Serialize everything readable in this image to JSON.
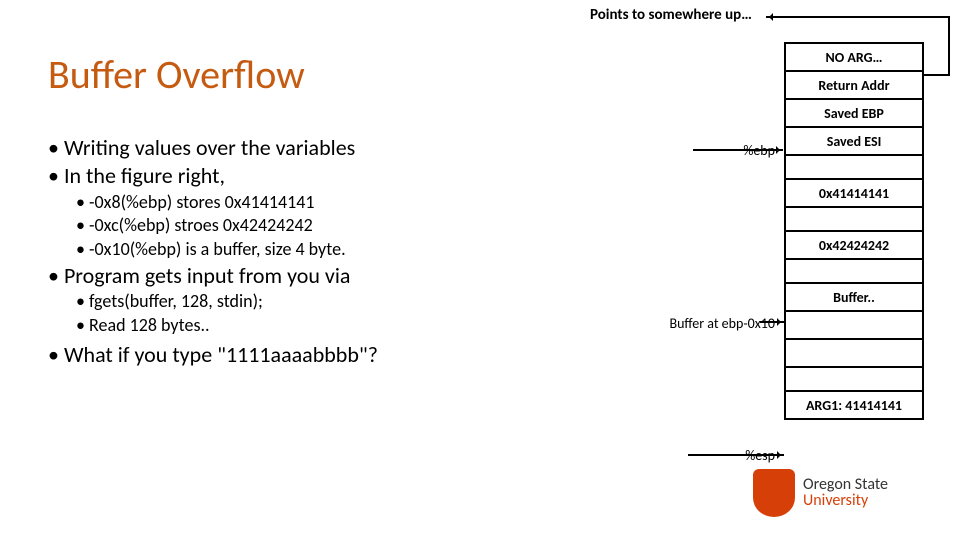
{
  "top_note": "Points to somewhere up…",
  "title": "Buffer Overflow",
  "bullets": {
    "b1": "Writing values over the variables",
    "b2": "In the figure right,",
    "sub1": "-0x8(%ebp) stores 0x41414141",
    "sub2": "-0xc(%ebp) stroes 0x42424242",
    "sub3": "-0x10(%ebp) is a buffer, size 4 byte.",
    "b3": "Program gets input from you via",
    "sub4": "fgets(buffer, 128, stdin);",
    "sub5": "Read 128 bytes..",
    "b4": "What if you type \"1111aaaabbbb\"?"
  },
  "stack": {
    "c0": "NO ARG…",
    "c1": "Return Addr",
    "c2": "Saved EBP",
    "c3": "Saved ESI",
    "c4": "0x41414141",
    "c5": "0x42424242",
    "c6": "Buffer..",
    "c7": "",
    "c8": "",
    "c9": "ARG1: 41414141"
  },
  "labels": {
    "ebp": "%ebp",
    "buf": "Buffer at ebp-0x10",
    "esp": "%esp"
  },
  "logo": {
    "line1": "Oregon State",
    "line2": "University"
  }
}
